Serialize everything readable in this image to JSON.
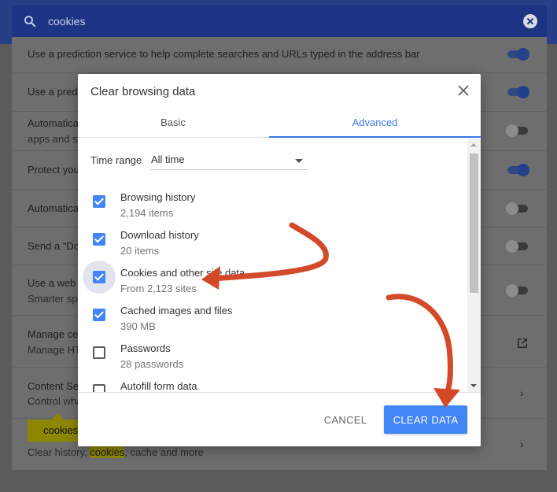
{
  "search": {
    "query": "cookies"
  },
  "settings": {
    "rows": [
      {
        "line1": "Use a prediction service to help complete searches and URLs typed in the address bar"
      },
      {
        "line1": "Use a predi"
      },
      {
        "line1": "Automatica",
        "line2": "apps and s"
      },
      {
        "line1": "Protect you"
      },
      {
        "line1": "Automatica"
      },
      {
        "line1": "Send a \"Do"
      },
      {
        "line1": "Use a web",
        "line2": "Smarter sp"
      },
      {
        "line1": "Manage ce",
        "line2": "Manage HT"
      },
      {
        "line1": "Content Se",
        "line2": "Control wha"
      },
      {
        "line2_before": "Clear history, ",
        "line2_highlight": "cookies",
        "line2_after": ", cache and more"
      }
    ],
    "highlight_bubble": "cookies"
  },
  "dialog": {
    "title": "Clear browsing data",
    "tabs": [
      {
        "label": "Basic"
      },
      {
        "label": "Advanced"
      }
    ],
    "time_range": {
      "label": "Time range",
      "value": "All time"
    },
    "items": [
      {
        "title": "Browsing history",
        "subtitle": "2,194 items"
      },
      {
        "title": "Download history",
        "subtitle": "20 items"
      },
      {
        "title": "Cookies and other site data",
        "subtitle": "From 2,123 sites"
      },
      {
        "title": "Cached images and files",
        "subtitle": "390 MB"
      },
      {
        "title": "Passwords",
        "subtitle": "28 passwords"
      },
      {
        "title": "Autofill form data",
        "subtitle": ""
      }
    ],
    "cancel_label": "CANCEL",
    "clear_label": "CLEAR DATA"
  },
  "colors": {
    "accent": "#4285f4",
    "tab_active": "#3b78e7",
    "annotation_arrow": "#d24a2a",
    "search_highlight": "#8d8700"
  }
}
